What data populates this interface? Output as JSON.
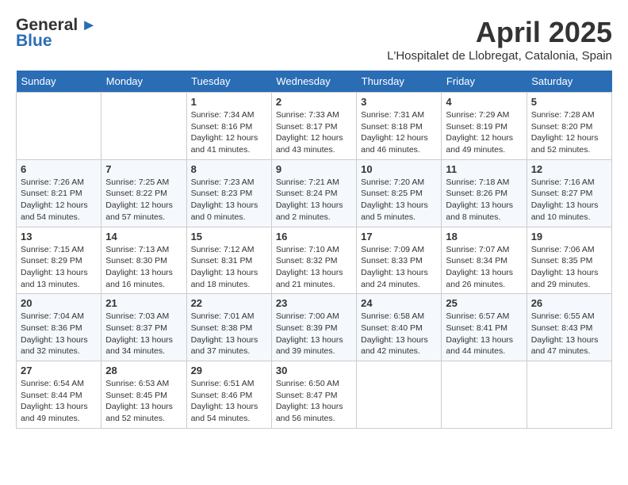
{
  "header": {
    "logo_general": "General",
    "logo_blue": "Blue",
    "month_title": "April 2025",
    "location": "L'Hospitalet de Llobregat, Catalonia, Spain"
  },
  "weekdays": [
    "Sunday",
    "Monday",
    "Tuesday",
    "Wednesday",
    "Thursday",
    "Friday",
    "Saturday"
  ],
  "weeks": [
    [
      {
        "day": "",
        "sunrise": "",
        "sunset": "",
        "daylight": ""
      },
      {
        "day": "",
        "sunrise": "",
        "sunset": "",
        "daylight": ""
      },
      {
        "day": "1",
        "sunrise": "Sunrise: 7:34 AM",
        "sunset": "Sunset: 8:16 PM",
        "daylight": "Daylight: 12 hours and 41 minutes."
      },
      {
        "day": "2",
        "sunrise": "Sunrise: 7:33 AM",
        "sunset": "Sunset: 8:17 PM",
        "daylight": "Daylight: 12 hours and 43 minutes."
      },
      {
        "day": "3",
        "sunrise": "Sunrise: 7:31 AM",
        "sunset": "Sunset: 8:18 PM",
        "daylight": "Daylight: 12 hours and 46 minutes."
      },
      {
        "day": "4",
        "sunrise": "Sunrise: 7:29 AM",
        "sunset": "Sunset: 8:19 PM",
        "daylight": "Daylight: 12 hours and 49 minutes."
      },
      {
        "day": "5",
        "sunrise": "Sunrise: 7:28 AM",
        "sunset": "Sunset: 8:20 PM",
        "daylight": "Daylight: 12 hours and 52 minutes."
      }
    ],
    [
      {
        "day": "6",
        "sunrise": "Sunrise: 7:26 AM",
        "sunset": "Sunset: 8:21 PM",
        "daylight": "Daylight: 12 hours and 54 minutes."
      },
      {
        "day": "7",
        "sunrise": "Sunrise: 7:25 AM",
        "sunset": "Sunset: 8:22 PM",
        "daylight": "Daylight: 12 hours and 57 minutes."
      },
      {
        "day": "8",
        "sunrise": "Sunrise: 7:23 AM",
        "sunset": "Sunset: 8:23 PM",
        "daylight": "Daylight: 13 hours and 0 minutes."
      },
      {
        "day": "9",
        "sunrise": "Sunrise: 7:21 AM",
        "sunset": "Sunset: 8:24 PM",
        "daylight": "Daylight: 13 hours and 2 minutes."
      },
      {
        "day": "10",
        "sunrise": "Sunrise: 7:20 AM",
        "sunset": "Sunset: 8:25 PM",
        "daylight": "Daylight: 13 hours and 5 minutes."
      },
      {
        "day": "11",
        "sunrise": "Sunrise: 7:18 AM",
        "sunset": "Sunset: 8:26 PM",
        "daylight": "Daylight: 13 hours and 8 minutes."
      },
      {
        "day": "12",
        "sunrise": "Sunrise: 7:16 AM",
        "sunset": "Sunset: 8:27 PM",
        "daylight": "Daylight: 13 hours and 10 minutes."
      }
    ],
    [
      {
        "day": "13",
        "sunrise": "Sunrise: 7:15 AM",
        "sunset": "Sunset: 8:29 PM",
        "daylight": "Daylight: 13 hours and 13 minutes."
      },
      {
        "day": "14",
        "sunrise": "Sunrise: 7:13 AM",
        "sunset": "Sunset: 8:30 PM",
        "daylight": "Daylight: 13 hours and 16 minutes."
      },
      {
        "day": "15",
        "sunrise": "Sunrise: 7:12 AM",
        "sunset": "Sunset: 8:31 PM",
        "daylight": "Daylight: 13 hours and 18 minutes."
      },
      {
        "day": "16",
        "sunrise": "Sunrise: 7:10 AM",
        "sunset": "Sunset: 8:32 PM",
        "daylight": "Daylight: 13 hours and 21 minutes."
      },
      {
        "day": "17",
        "sunrise": "Sunrise: 7:09 AM",
        "sunset": "Sunset: 8:33 PM",
        "daylight": "Daylight: 13 hours and 24 minutes."
      },
      {
        "day": "18",
        "sunrise": "Sunrise: 7:07 AM",
        "sunset": "Sunset: 8:34 PM",
        "daylight": "Daylight: 13 hours and 26 minutes."
      },
      {
        "day": "19",
        "sunrise": "Sunrise: 7:06 AM",
        "sunset": "Sunset: 8:35 PM",
        "daylight": "Daylight: 13 hours and 29 minutes."
      }
    ],
    [
      {
        "day": "20",
        "sunrise": "Sunrise: 7:04 AM",
        "sunset": "Sunset: 8:36 PM",
        "daylight": "Daylight: 13 hours and 32 minutes."
      },
      {
        "day": "21",
        "sunrise": "Sunrise: 7:03 AM",
        "sunset": "Sunset: 8:37 PM",
        "daylight": "Daylight: 13 hours and 34 minutes."
      },
      {
        "day": "22",
        "sunrise": "Sunrise: 7:01 AM",
        "sunset": "Sunset: 8:38 PM",
        "daylight": "Daylight: 13 hours and 37 minutes."
      },
      {
        "day": "23",
        "sunrise": "Sunrise: 7:00 AM",
        "sunset": "Sunset: 8:39 PM",
        "daylight": "Daylight: 13 hours and 39 minutes."
      },
      {
        "day": "24",
        "sunrise": "Sunrise: 6:58 AM",
        "sunset": "Sunset: 8:40 PM",
        "daylight": "Daylight: 13 hours and 42 minutes."
      },
      {
        "day": "25",
        "sunrise": "Sunrise: 6:57 AM",
        "sunset": "Sunset: 8:41 PM",
        "daylight": "Daylight: 13 hours and 44 minutes."
      },
      {
        "day": "26",
        "sunrise": "Sunrise: 6:55 AM",
        "sunset": "Sunset: 8:43 PM",
        "daylight": "Daylight: 13 hours and 47 minutes."
      }
    ],
    [
      {
        "day": "27",
        "sunrise": "Sunrise: 6:54 AM",
        "sunset": "Sunset: 8:44 PM",
        "daylight": "Daylight: 13 hours and 49 minutes."
      },
      {
        "day": "28",
        "sunrise": "Sunrise: 6:53 AM",
        "sunset": "Sunset: 8:45 PM",
        "daylight": "Daylight: 13 hours and 52 minutes."
      },
      {
        "day": "29",
        "sunrise": "Sunrise: 6:51 AM",
        "sunset": "Sunset: 8:46 PM",
        "daylight": "Daylight: 13 hours and 54 minutes."
      },
      {
        "day": "30",
        "sunrise": "Sunrise: 6:50 AM",
        "sunset": "Sunset: 8:47 PM",
        "daylight": "Daylight: 13 hours and 56 minutes."
      },
      {
        "day": "",
        "sunrise": "",
        "sunset": "",
        "daylight": ""
      },
      {
        "day": "",
        "sunrise": "",
        "sunset": "",
        "daylight": ""
      },
      {
        "day": "",
        "sunrise": "",
        "sunset": "",
        "daylight": ""
      }
    ]
  ]
}
